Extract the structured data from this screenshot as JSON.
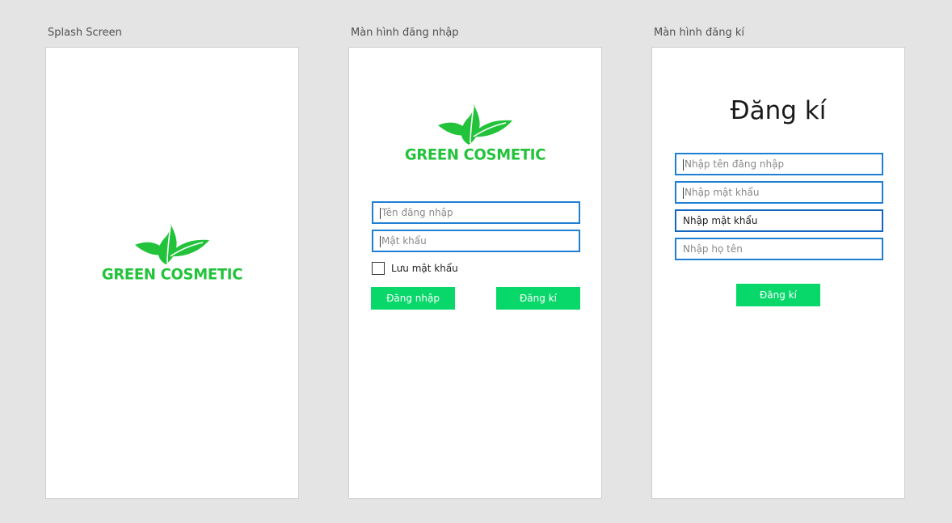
{
  "colors": {
    "brand_green": "#22c33a",
    "button_green": "#08d86a",
    "input_border": "#1f7fd3"
  },
  "brand": {
    "logo_icon": "leaf-icon",
    "name": "GREEN COSMETIC"
  },
  "screens": {
    "splash": {
      "title": "Splash Screen"
    },
    "login": {
      "title": "Màn hình đăng nhập",
      "username_placeholder": "Tên đăng nhập",
      "password_placeholder": "Mật khẩu",
      "remember_label": "Lưu mật khẩu",
      "remember_checked": false,
      "login_button": "Đăng nhập",
      "register_button": "Đăng kí"
    },
    "register": {
      "title": "Màn hình đăng kí",
      "heading": "Đăng kí",
      "username_placeholder": "Nhập tên đăng nhập",
      "password_placeholder": "Nhập mật khẩu",
      "confirm_password_value": "Nhập mật khẩu",
      "fullname_placeholder": "Nhập họ tên",
      "submit_button": "Đăng kí"
    }
  }
}
